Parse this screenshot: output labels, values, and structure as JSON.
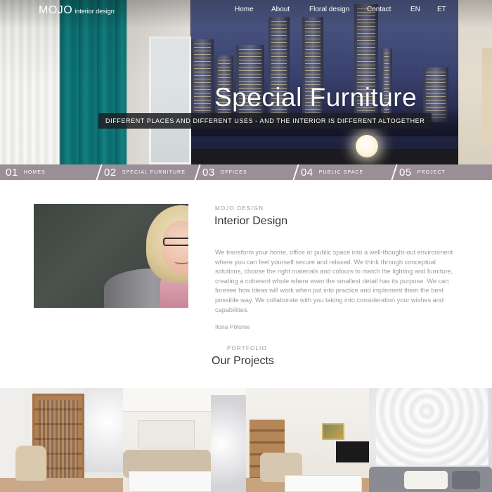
{
  "brand": {
    "logo_main": "MOJO",
    "logo_sub": "interior design"
  },
  "nav": {
    "items": [
      {
        "label": "Home"
      },
      {
        "label": "About"
      },
      {
        "label": "Floral design"
      },
      {
        "label": "Contact"
      },
      {
        "label": "EN"
      },
      {
        "label": "ET"
      }
    ]
  },
  "hero": {
    "title": "Special Furniture",
    "subtitle": "DIFFERENT PLACES AND DIFFERENT USES - AND THE INTERIOR IS DIFFERENT ALTOGETHER"
  },
  "categories": [
    {
      "num": "01",
      "label": "HOMES"
    },
    {
      "num": "02",
      "label": "SPECIAL FURNITURE"
    },
    {
      "num": "03",
      "label": "OFFICES"
    },
    {
      "num": "04",
      "label": "PUBLIC SPACE"
    },
    {
      "num": "05",
      "label": "PROJECT"
    }
  ],
  "about": {
    "kicker": "MOJO DESIGN",
    "title": "Interior Design",
    "text": "We transform your home, office or public space into a well-thought-out environment where you can feel yourself secure and relaxed. We think through conceptual solutions, choose the right materials and colours to match the lighting and furniture, creating a coherent whole where even the smallest detail has its purpose. We can foresee how ideas will work when put into practice and implement them the best possible way. We collaborate with you taking into consideration your wishes and capabilities.",
    "signature": "Ilona Põlome"
  },
  "projects": {
    "kicker": "PORTFOLIO",
    "title": "Our Projects"
  },
  "colors": {
    "strip_bg": "#9a8f96",
    "text_muted": "#9b9b9b",
    "heading": "#333333"
  }
}
